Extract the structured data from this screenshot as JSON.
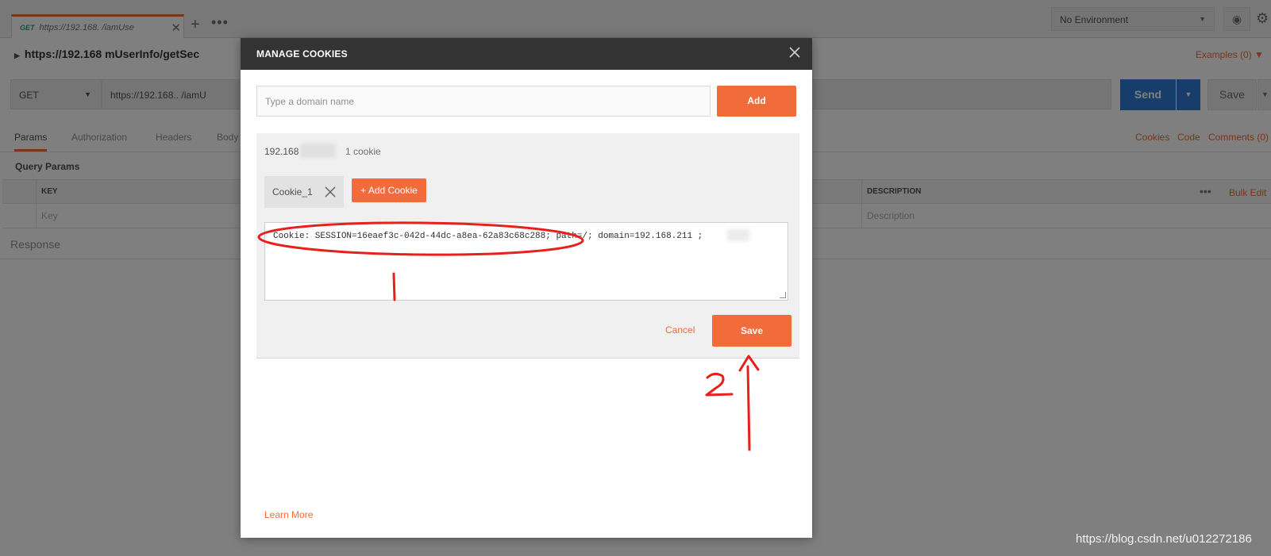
{
  "background": {
    "request_tab": {
      "method": "GET",
      "url": "https://192.168.          /iamUse"
    },
    "environment": {
      "selected": "No Environment"
    },
    "url_breadcrumb": "https://192.168            mUserInfo/getSec",
    "examples_label": "Examples (0)",
    "request": {
      "method": "GET",
      "url": "https://192.168..         /iamU",
      "send_label": "Send",
      "save_label": "Save"
    },
    "subtabs": [
      "Params",
      "Authorization",
      "Headers",
      "Body"
    ],
    "right_links": [
      "Cookies",
      "Code",
      "Comments (0)"
    ],
    "query_params": {
      "title": "Query Params",
      "columns": [
        "KEY",
        "DESCRIPTION"
      ],
      "placeholders": {
        "key": "Key",
        "description": "Description"
      },
      "bulk_edit": "Bulk Edit"
    },
    "response_label": "Response"
  },
  "modal": {
    "title": "MANAGE COOKIES",
    "domain_input_placeholder": "Type a domain name",
    "add_label": "Add",
    "domain": {
      "name": "192.168",
      "cookie_count": "1 cookie"
    },
    "cookie_chip": "Cookie_1",
    "add_cookie_label": "+ Add Cookie",
    "cookie_value": "Cookie: SESSION=16eaef3c-042d-44dc-a8ea-62a83c68c288; path=/; domain=192.168.211      ;",
    "cancel_label": "Cancel",
    "save_label": "Save",
    "learn_more_label": "Learn More"
  },
  "watermark": "https://blog.csdn.net/u012272186",
  "colors": {
    "accent": "#f26b3a",
    "send": "#2f7bd5",
    "modal_header": "#333333",
    "annotation": "#e8201c"
  }
}
